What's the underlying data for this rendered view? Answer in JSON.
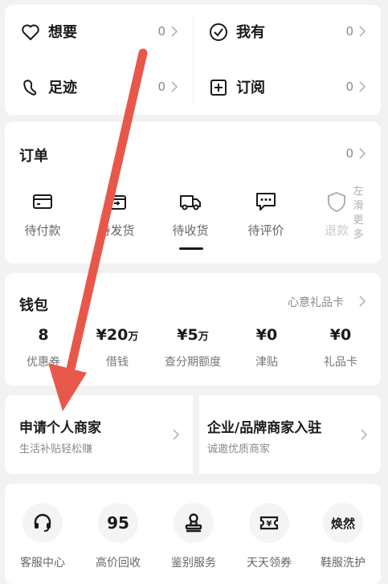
{
  "top": {
    "wish": {
      "label": "想要",
      "count": "0",
      "icon": "heart-icon"
    },
    "own": {
      "label": "我有",
      "count": "0",
      "icon": "check-circle-icon"
    },
    "footprint": {
      "label": "足迹",
      "count": "0",
      "icon": "footprint-icon"
    },
    "subscribe": {
      "label": "订阅",
      "count": "0",
      "icon": "plus-square-icon"
    }
  },
  "orders": {
    "title": "订单",
    "count": "0",
    "items": [
      {
        "label": "待付款",
        "icon": "card-icon"
      },
      {
        "label": "待发货",
        "icon": "box-send-icon"
      },
      {
        "label": "待收货",
        "icon": "truck-icon"
      },
      {
        "label": "待评价",
        "icon": "comment-icon"
      },
      {
        "label": "退款",
        "icon": "refund-icon"
      }
    ],
    "hint": "左滑更多"
  },
  "wallet": {
    "title": "钱包",
    "link": "心意礼品卡",
    "items": [
      {
        "value": "8",
        "unit": "",
        "label": "优惠券"
      },
      {
        "value": "¥20",
        "unit": "万",
        "label": "借钱"
      },
      {
        "value": "¥5",
        "unit": "万",
        "label": "查分期额度"
      },
      {
        "value": "¥0",
        "unit": "",
        "label": "津贴"
      },
      {
        "value": "¥0",
        "unit": "",
        "label": "礼品卡"
      }
    ]
  },
  "merchant": {
    "personal": {
      "title": "申请个人商家",
      "subtitle": "生活补贴轻松赚"
    },
    "brand": {
      "title": "企业/品牌商家入驻",
      "subtitle": "诚邀优质商家"
    }
  },
  "services": [
    {
      "label": "客服中心",
      "icon": "headset-icon"
    },
    {
      "label": "高价回收",
      "icon": "recycle-95-icon",
      "glyph": "95"
    },
    {
      "label": "鉴别服务",
      "icon": "stamp-icon"
    },
    {
      "label": "天天领券",
      "icon": "coupon-icon"
    },
    {
      "label": "鞋服洗护",
      "icon": "wash-icon",
      "glyph": "焕然"
    }
  ],
  "colors": {
    "accent_arrow": "#e8584a",
    "muted_text": "#8a8a8a",
    "background": "#f2f2f2"
  }
}
